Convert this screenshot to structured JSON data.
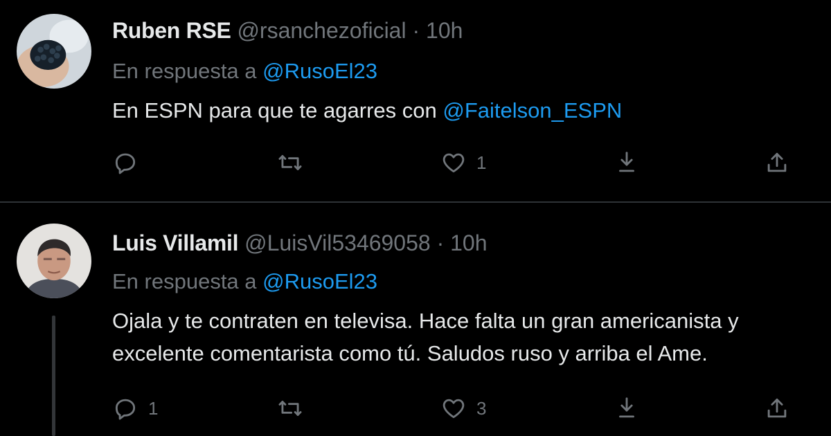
{
  "tweets": [
    {
      "name": "Ruben RSE",
      "handle": "@rsanchezoficial",
      "separator": "·",
      "time": "10h",
      "reply_prefix": "En respuesta a",
      "reply_to": "@RusoEl23",
      "text_prefix": "En ESPN para que te agarres con ",
      "text_mention": "@Faitelson_ESPN",
      "counts": {
        "replies": "",
        "retweets": "",
        "likes": "1"
      }
    },
    {
      "name": "Luis Villamil",
      "handle": "@LuisVil53469058",
      "separator": "·",
      "time": "10h",
      "reply_prefix": "En respuesta a",
      "reply_to": "@RusoEl23",
      "text_lines": [
        "Ojala y te contraten en televisa. Hace falta un gran americanista y",
        "excelente comentarista como tú. Saludos ruso y arriba el Ame."
      ],
      "counts": {
        "replies": "1",
        "retweets": "",
        "likes": "3"
      }
    }
  ],
  "colors": {
    "background": "#000000",
    "text": "#e7e9ea",
    "muted": "#71767b",
    "accent": "#1d9bf0",
    "divider": "#2f3336"
  },
  "icons": [
    "reply-icon",
    "retweet-icon",
    "like-icon",
    "bookmark-icon",
    "share-icon"
  ]
}
